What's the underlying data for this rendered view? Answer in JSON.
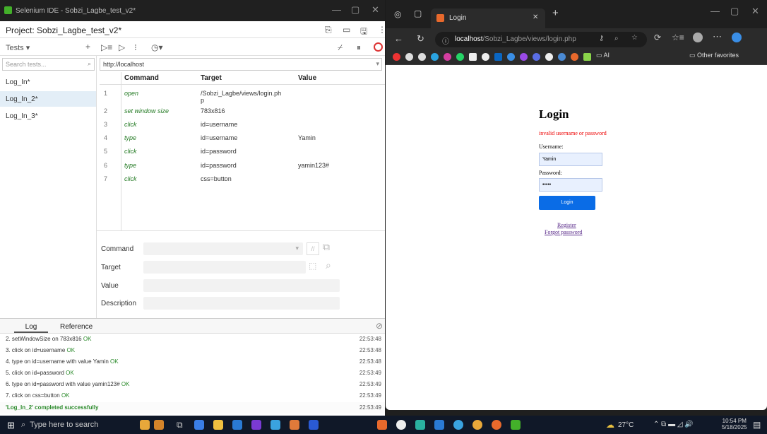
{
  "selenium": {
    "window_title": "Selenium IDE - Sobzi_Lagbe_test_v2*",
    "project": "Project: Sobzi_Lagbe_test_v2*",
    "tests_label": "Tests",
    "search_placeholder": "Search tests...",
    "tests": [
      "Log_In*",
      "Log_In_2*",
      "Log_In_3*"
    ],
    "selected_test": 1,
    "base_url": "http://localhost",
    "headers": {
      "command": "Command",
      "target": "Target",
      "value": "Value"
    },
    "rows": [
      {
        "n": "1",
        "cmd": "open",
        "target": "/Sobzi_Lagbe/views/login.ph",
        "target2": "p",
        "value": ""
      },
      {
        "n": "2",
        "cmd": "set window size",
        "target": "783x816",
        "value": ""
      },
      {
        "n": "3",
        "cmd": "click",
        "target": "id=username",
        "value": ""
      },
      {
        "n": "4",
        "cmd": "type",
        "target": "id=username",
        "value": "Yamin"
      },
      {
        "n": "5",
        "cmd": "click",
        "target": "id=password",
        "value": ""
      },
      {
        "n": "6",
        "cmd": "type",
        "target": "id=password",
        "value": "yamin123#"
      },
      {
        "n": "7",
        "cmd": "click",
        "target": "css=button",
        "value": ""
      }
    ],
    "editor": {
      "command": "Command",
      "target": "Target",
      "value": "Value",
      "description": "Description"
    },
    "log_tabs": {
      "log": "Log",
      "reference": "Reference"
    },
    "log": [
      {
        "msg": "2.  setWindowSize on 783x816",
        "ok": "OK",
        "time": "22:53:48"
      },
      {
        "msg": "3.  click on id=username",
        "ok": "OK",
        "time": "22:53:48"
      },
      {
        "msg": "4.  type on id=username with value Yamin",
        "ok": "OK",
        "time": "22:53:48"
      },
      {
        "msg": "5.  click on id=password",
        "ok": "OK",
        "time": "22:53:49"
      },
      {
        "msg": "6.  type on id=password with value yamin123#",
        "ok": "OK",
        "time": "22:53:49"
      },
      {
        "msg": "7.  click on css=button",
        "ok": "OK",
        "time": "22:53:49"
      }
    ],
    "log_done": {
      "msg": "'Log_In_2' completed successfully",
      "time": "22:53:49"
    }
  },
  "browser": {
    "tab_title": "Login",
    "url_host": "localhost",
    "url_path": "/Sobzi_Lagbe/views/login.php",
    "other_favorites": "Other favorites",
    "ai_label": "AI",
    "page": {
      "title": "Login",
      "error": "invalid username or password",
      "username_label": "Username:",
      "username_value": "Yamin",
      "password_label": "Password:",
      "password_value": "•••••",
      "button": "Login",
      "register": "Register",
      "forgot": "Forgot password"
    }
  },
  "taskbar": {
    "search": "Type here to search",
    "weather": "27°C",
    "time": "10:54 PM",
    "date": "5/18/2025"
  },
  "colors": {
    "accent": "#0a6ce6",
    "ok": "#2a8a2a",
    "error": "#ee0000",
    "taskbar": "#101828"
  }
}
